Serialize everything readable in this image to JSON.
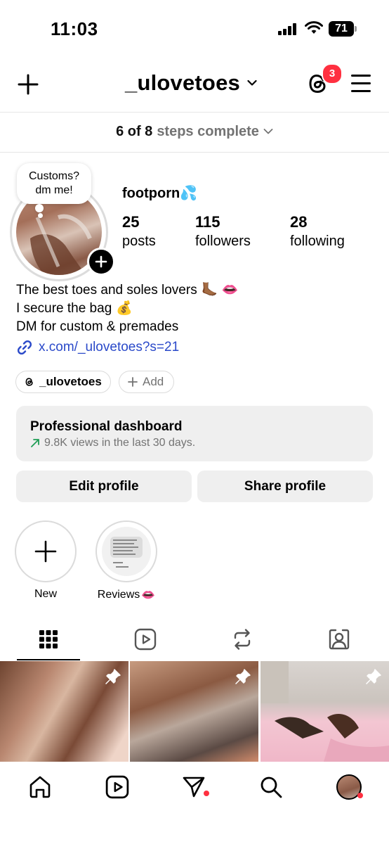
{
  "status_bar": {
    "time": "11:03",
    "battery": "71"
  },
  "header": {
    "username": "_ulovetoes",
    "notification_count": "3"
  },
  "steps": {
    "progress": "6 of 8",
    "label": "steps complete"
  },
  "profile": {
    "note": [
      "Customs?",
      "dm me!"
    ],
    "display_name": "footporn",
    "display_name_emoji": "💦",
    "stats": [
      {
        "value": "25",
        "label": "posts"
      },
      {
        "value": "115",
        "label": "followers"
      },
      {
        "value": "28",
        "label": "following"
      }
    ],
    "bio": [
      {
        "text": "The best toes and soles lovers",
        "emoji": "🦶🏾 👄"
      },
      {
        "text": "I secure the bag",
        "emoji": "💰"
      },
      {
        "text": "DM for custom & premades",
        "emoji": ""
      }
    ],
    "link": "x.com/_ulovetoes?s=21"
  },
  "chips": {
    "threads": "_ulovetoes",
    "add": "Add"
  },
  "dashboard": {
    "title": "Professional dashboard",
    "subtitle": "9.8K views in the last 30 days."
  },
  "buttons": {
    "edit": "Edit profile",
    "share": "Share profile"
  },
  "highlights": [
    {
      "label": "New",
      "emoji": ""
    },
    {
      "label": "Reviews",
      "emoji": "👄"
    }
  ],
  "tabs": [
    "grid-icon",
    "reels-icon",
    "reposts-icon",
    "tagged-icon"
  ],
  "bottom_nav": [
    "home-icon",
    "reels-icon",
    "messages-icon",
    "search-icon",
    "profile-avatar"
  ]
}
